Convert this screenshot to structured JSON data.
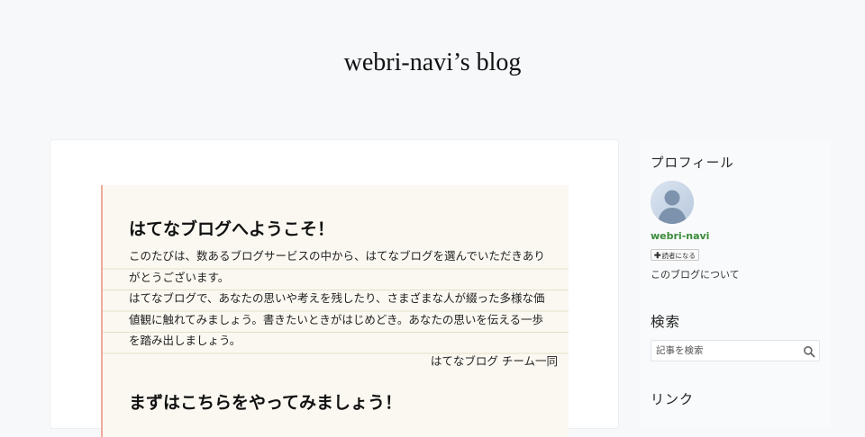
{
  "header": {
    "blog_title": "webri-navi’s blog"
  },
  "welcome": {
    "title": "はてなブログへようこそ！",
    "paragraphs": [
      "このたびは、数あるブログサービスの中から、はてなブログを選んでいただきありがとうございます。",
      "はてなブログで、あなたの思いや考えを残したり、さまざまな人が綴った多様な価値観に触れてみましょう。書きたいときがはじめどき。あなたの思いを伝える一歩を踏み出しましょう。"
    ],
    "signature": "はてなブログ チーム一同",
    "subtitle": "まずはこちらをやってみましょう！"
  },
  "sidebar": {
    "profile": {
      "heading": "プロフィール",
      "username": "webri-navi",
      "follow_label": "読者になる",
      "about_link": "このブログについて"
    },
    "search": {
      "heading": "検索",
      "placeholder": "記事を検索"
    },
    "links": {
      "heading": "リンク"
    }
  },
  "icons": {
    "avatar": "default-user-avatar-icon",
    "follow": "plus-icon",
    "search": "magnifier-icon"
  },
  "colors": {
    "page_background": "#f7f8fa",
    "welcome_background": "#faf8f1",
    "welcome_margin_line": "#f0a99c",
    "username": "#3a8b3a"
  }
}
